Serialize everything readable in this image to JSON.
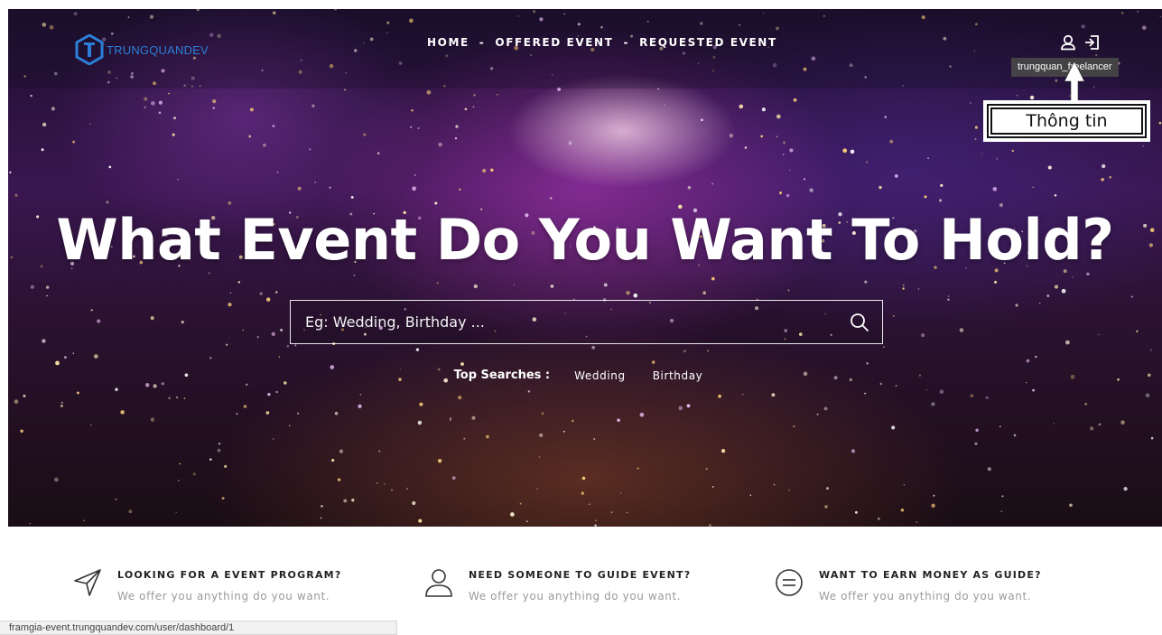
{
  "brand": {
    "logo_text": "TRUNGQUANDEV"
  },
  "nav": {
    "items": [
      {
        "label": "HOME"
      },
      {
        "label": "OFFERED EVENT"
      },
      {
        "label": "REQUESTED EVENT"
      }
    ],
    "separator": "-"
  },
  "user": {
    "tooltip": "trungquan_freelancer",
    "icons": [
      "user-icon",
      "logout-icon"
    ]
  },
  "annotation": {
    "callout_text": "Thông tin"
  },
  "hero": {
    "headline": "What Event Do You Want To Hold?",
    "search_placeholder": "Eg: Wedding, Birthday ...",
    "top_searches_label": "Top Searches :",
    "top_searches": [
      "Wedding",
      "Birthday"
    ]
  },
  "features": [
    {
      "icon": "paper-plane-icon",
      "title": "LOOKING FOR A EVENT PROGRAM?",
      "desc": "We offer you anything do you want."
    },
    {
      "icon": "person-icon",
      "title": "NEED SOMEONE TO GUIDE EVENT?",
      "desc": "We offer you anything do you want."
    },
    {
      "icon": "equals-circle-icon",
      "title": "WANT TO EARN MONEY AS GUIDE?",
      "desc": "We offer you anything do you want."
    }
  ],
  "status_url": "framgia-event.trungquandev.com/user/dashboard/1",
  "colors": {
    "logo_blue": "#2b7fd8",
    "hero_purple": "#3a1650",
    "feature_desc": "#9a9a9a"
  }
}
